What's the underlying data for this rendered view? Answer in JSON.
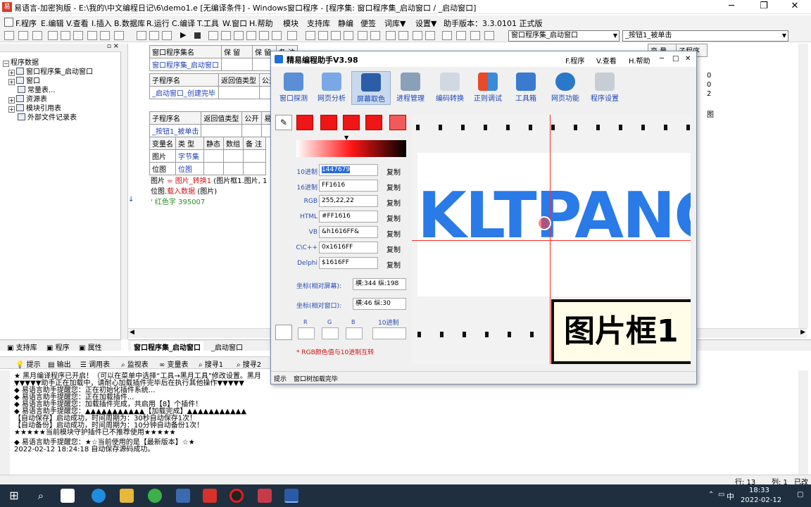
{
  "window": {
    "title": "易语言-加密狗版 - E:\\我的\\中文编程日记\\6\\demo1.e [无编译条件] - Windows窗口程序 - [程序集: 窗口程序集_启动窗口 / _启动窗口]"
  },
  "menu": [
    "F.程序",
    "E.编辑",
    "V.查看",
    "I.插入",
    "B.数据库",
    "R.运行",
    "C.编译",
    "T.工具",
    "W.窗口",
    "H.帮助",
    "模块",
    "支持库",
    "静编",
    "便签",
    "词库▼",
    "设置▼",
    "助手版本：3.3.0101 正式版"
  ],
  "toolbar": {
    "combo_left": "窗口程序集_启动窗口",
    "combo_right": "_按钮1_被单击"
  },
  "tree": {
    "root": "程序数据",
    "items": [
      "窗口程序集_启动窗口",
      "窗口",
      "常量表...",
      "资源表",
      "模块引用表",
      "外部文件记录表"
    ]
  },
  "left_tabs": [
    "支持库",
    "程序",
    "属性"
  ],
  "code": {
    "t1": {
      "c1": "窗口程序集名",
      "c2": "保 留",
      "c3": "保 留",
      "c4": "备 注",
      "v1": "窗口程序集_启动窗口"
    },
    "t2": {
      "c1": "子程序名",
      "c2": "返回值类型",
      "c3": "公开",
      "v1": "_启动窗口_创建完毕"
    },
    "t3": {
      "c1": "子程序名",
      "c2": "返回值类型",
      "c3": "公开",
      "c4": "易",
      "v1": "_按钮1_被单击"
    },
    "t4": {
      "c1": "变量名",
      "c2": "类 型",
      "c3": "静态",
      "c4": "数组",
      "c5": "备 注",
      "r1a": "图片",
      "r1b": "字节集",
      "r2a": "位图",
      "r2b": "位图"
    },
    "line1_a": "图片",
    "line1_b": " = ",
    "line1_c": "图片_转换1",
    "line1_d": " (图片框1.图片, 1",
    "line2_a": "位图.",
    "line2_b": "载入数据",
    "line2_c": " (图片)",
    "line3": "' 红色字 395007",
    "right_header_a": "变 量",
    "right_header_b": "子程序",
    "right_vals": [
      "0",
      "0",
      "2",
      "图"
    ]
  },
  "code_tabs": [
    "窗口程序集_启动窗口",
    "_启动窗口"
  ],
  "bottom_tabs": [
    "提示",
    "输出",
    "调用表",
    "监视表",
    "变量表",
    "搜寻1",
    "搜寻2"
  ],
  "output_lines": [
    "★ 黑月编译程序已开启！（可以在菜单中选择“工具→黑月工具”修改设置。黑月",
    "▼▼▼▼▼助手正在加载中，请耐心加载插件完毕后在执行其他操作▼▼▼▼▼",
    "◆ 易语言助手提醒您：正在初始化插件系统...",
    "◆ 易语言助手提醒您：正在加载插件...",
    "◆ 易语言助手提醒您：加载插件完成，共启用【8】个插件！",
    "◆ 易语言助手提醒您：▲▲▲▲▲▲▲▲▲▲▲【加载完成】▲▲▲▲▲▲▲▲▲▲▲",
    "【自动保存】启动成功，时间周期为：30秒自动保存1次！",
    "【自动备份】启动成功，时间周期为：10分钟自动备份1次！",
    "★★★★★当前模块守护插件已不推荐使用★★★★★",
    "",
    "◆ 易语言助手提醒您：★☆当前使用的是【最新版本】☆★",
    "2022-02-12 18:24:18 自动保存源码成功。"
  ],
  "status": {
    "row": "行: 13",
    "col": "列: 1",
    "mode": "已改"
  },
  "taskbar": {
    "lang": "中",
    "time": "18:33",
    "date": "2022-02-12"
  },
  "dialog": {
    "title": "精易编程助手V3.98",
    "menu": [
      "F.程序",
      "V.查看",
      "H.帮助"
    ],
    "tools": [
      "窗口探测",
      "网页分析",
      "屏幕取色",
      "进程管理",
      "编码转换",
      "正则调试",
      "工具箱",
      "网页功能",
      "程序设置"
    ],
    "fields": [
      {
        "label": "10进制",
        "value": "1447679"
      },
      {
        "label": "16进制",
        "value": "FF1616"
      },
      {
        "label": "RGB",
        "value": "255,22,22"
      },
      {
        "label": "HTML",
        "value": "#FF1616"
      },
      {
        "label": "VB",
        "value": "&h1616FF&"
      },
      {
        "label": "C\\C++",
        "value": "0x1616FF"
      },
      {
        "label": "Delphi",
        "value": "$1616FF"
      }
    ],
    "copy_label": "复制",
    "coord_screen_label": "坐标(相对屏幕):",
    "coord_screen_value": "横:344 纵:198",
    "coord_window_label": "坐标(相对窗口):",
    "coord_window_value": "横:46 纵:30",
    "r_label": "R",
    "g_label": "G",
    "b_label": "B",
    "dec_label": "10进制",
    "hint": "* RGB颜色值与10进制互转",
    "preview_text": "KLTPANG",
    "preview_box_text": "图片框1",
    "status_left": "提示",
    "status_right": "窗口树加载完毕"
  },
  "colors": {
    "picked": "#ff1616",
    "accent_blue": "#1b46b8",
    "taskbar": "#1f2f3f"
  }
}
